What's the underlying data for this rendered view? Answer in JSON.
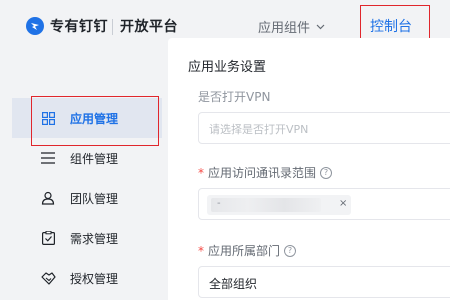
{
  "header": {
    "brand": "专有钉钉",
    "brand_sub": "开放平台",
    "nav_components": "应用组件",
    "nav_console": "控制台"
  },
  "sidebar": {
    "items": [
      {
        "label": "应用管理",
        "icon": "grid-icon",
        "active": true
      },
      {
        "label": "组件管理",
        "icon": "list-icon",
        "active": false
      },
      {
        "label": "团队管理",
        "icon": "team-icon",
        "active": false
      },
      {
        "label": "需求管理",
        "icon": "clipboard-check-icon",
        "active": false
      },
      {
        "label": "授权管理",
        "icon": "handshake-icon",
        "active": false
      }
    ]
  },
  "panel": {
    "title": "应用业务设置",
    "vpn_label": "是否打开VPN",
    "vpn_placeholder": "请选择是否打开VPN",
    "scope_label": "应用访问通讯录范围",
    "scope_tag": "-",
    "dept_label": "应用所属部门",
    "dept_value": "全部组织"
  },
  "colors": {
    "accent": "#1f72e6",
    "highlight_box": "#e0262c",
    "required_star": "#f54a45"
  }
}
